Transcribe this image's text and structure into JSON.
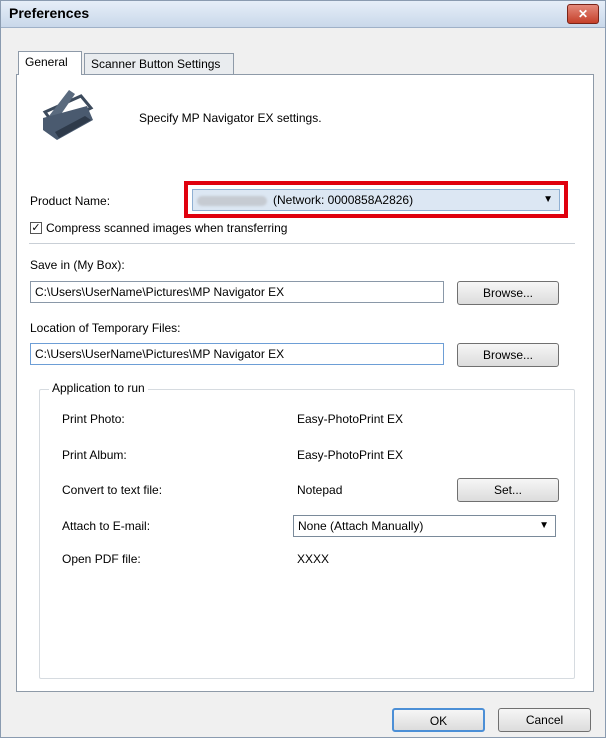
{
  "window": {
    "title": "Preferences",
    "close_glyph": "✕"
  },
  "tabs": [
    {
      "label": "General",
      "active": true
    },
    {
      "label": "Scanner Button Settings",
      "active": false
    }
  ],
  "header": {
    "icon": "scanner-icon",
    "description": "Specify MP Navigator EX settings."
  },
  "product": {
    "label": "Product Name:",
    "value": "(Network: 0000858A2826)",
    "highlight_color": "#e0000e"
  },
  "compress": {
    "checked": true,
    "label": "Compress scanned images when transferring"
  },
  "save_in": {
    "label": "Save in (My Box):",
    "value": "C:\\Users\\UserName\\Pictures\\MP Navigator EX",
    "browse_label": "Browse..."
  },
  "temp_files": {
    "label": "Location of Temporary Files:",
    "value": "C:\\Users\\UserName\\Pictures\\MP Navigator EX",
    "browse_label": "Browse..."
  },
  "apps": {
    "group_title": "Application to run",
    "print_photo": {
      "label": "Print Photo:",
      "value": "Easy-PhotoPrint EX"
    },
    "print_album": {
      "label": "Print Album:",
      "value": "Easy-PhotoPrint EX"
    },
    "convert_text": {
      "label": "Convert to text file:",
      "value": "Notepad",
      "set_label": "Set..."
    },
    "attach_email": {
      "label": "Attach to E-mail:",
      "value": "None (Attach Manually)"
    },
    "open_pdf": {
      "label": "Open PDF file:",
      "value": "XXXX"
    }
  },
  "footer": {
    "ok_label": "OK",
    "cancel_label": "Cancel",
    "focus_color": "#4c8fd6"
  }
}
